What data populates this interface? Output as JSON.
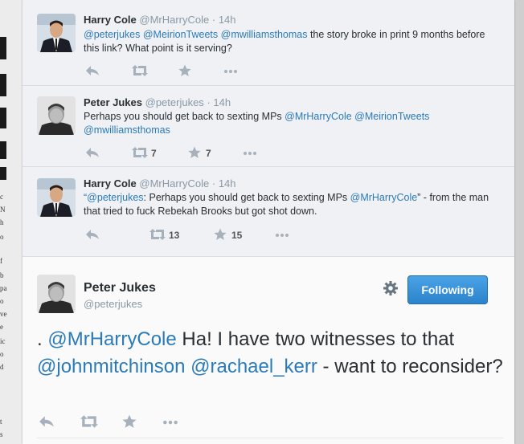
{
  "background_fragments": [
    "B",
    "A",
    "o",
    "g",
    "c",
    "N",
    "h",
    "o",
    "f",
    "b",
    "pa",
    "o",
    "ve",
    "e",
    "ic",
    "o",
    "d",
    "t",
    "s"
  ],
  "tweets": [
    {
      "name": "Harry Cole",
      "handle": "@MrHarryCole",
      "time": "14h",
      "body": [
        {
          "text": "@peterjukes",
          "mention": true
        },
        {
          "text": " ",
          "mention": false
        },
        {
          "text": "@MeirionTweets",
          "mention": true
        },
        {
          "text": " ",
          "mention": false
        },
        {
          "text": "@mwilliamsthomas",
          "mention": true
        },
        {
          "text": " the story broke in print 9 months before this link? What point is it serving?",
          "mention": false
        }
      ],
      "retweets": "",
      "favorites": "",
      "avatar": "suited-man-photo"
    },
    {
      "name": "Peter Jukes",
      "handle": "@peterjukes",
      "time": "14h",
      "body": [
        {
          "text": "Perhaps you should get back to sexting MPs ",
          "mention": false
        },
        {
          "text": "@MrHarryCole",
          "mention": true
        },
        {
          "text": " ",
          "mention": false
        },
        {
          "text": "@MeirionTweets",
          "mention": true
        },
        {
          "text": " ",
          "mention": false
        },
        {
          "text": "@mwilliamsthomas",
          "mention": true
        }
      ],
      "retweets": "7",
      "favorites": "7",
      "avatar": "bw-portrait-photo"
    },
    {
      "name": "Harry Cole",
      "handle": "@MrHarryCole",
      "time": "14h",
      "body": [
        {
          "text": "“",
          "mention": false
        },
        {
          "text": "@peterjukes",
          "mention": true
        },
        {
          "text": ": Perhaps you should get back to sexting MPs ",
          "mention": false
        },
        {
          "text": "@MrHarryCole",
          "mention": true
        },
        {
          "text": "” - from the man that tried to fuck Rebekah Brooks but got shot down.",
          "mention": false
        }
      ],
      "retweets": "13",
      "favorites": "15",
      "avatar": "suited-man-photo"
    }
  ],
  "main_tweet": {
    "name": "Peter Jukes",
    "handle": "@peterjukes",
    "follow_label": "Following",
    "body": [
      {
        "text": ". ",
        "mention": false
      },
      {
        "text": "@MrHarryCole",
        "mention": true
      },
      {
        "text": " Ha! I have two witnesses to that ",
        "mention": false
      },
      {
        "text": "@johnmitchinson",
        "mention": true
      },
      {
        "text": " ",
        "mention": false
      },
      {
        "text": "@rachael_kerr",
        "mention": true
      },
      {
        "text": " - want to reconsider?",
        "mention": false
      }
    ],
    "avatar": "bw-portrait-photo"
  },
  "icons": {
    "reply": "reply-icon",
    "retweet": "retweet-icon",
    "favorite": "star-icon",
    "more": "more-icon",
    "gear": "gear-icon"
  },
  "colors": {
    "mention": "#2b7bb9",
    "follow_button": "#2b84cc",
    "tweet_bg": "#eff1f5"
  }
}
